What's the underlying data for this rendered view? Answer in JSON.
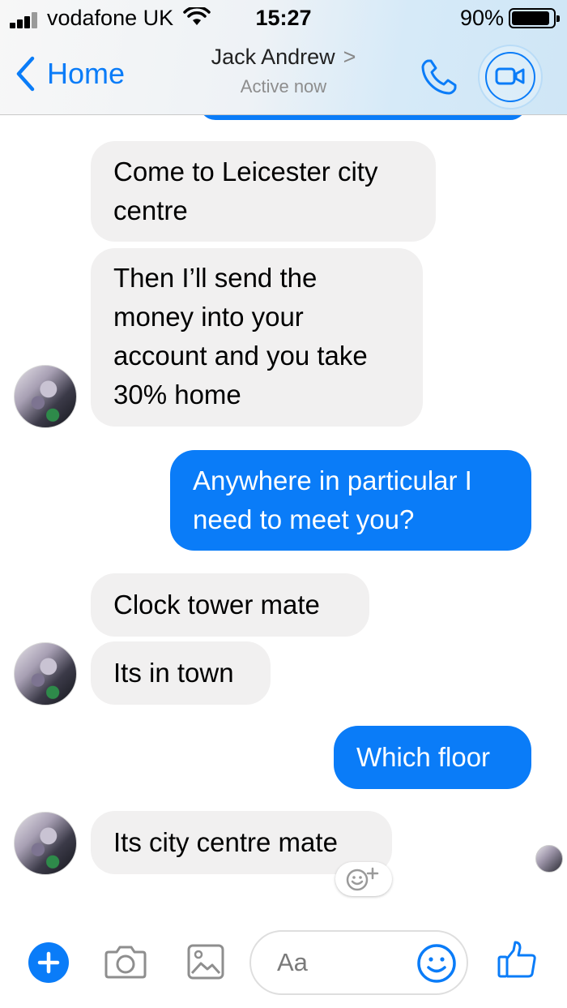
{
  "status_bar": {
    "carrier": "vodafone UK",
    "time": "15:27",
    "battery": "90%"
  },
  "header": {
    "back_label": "Home",
    "contact_name": "Jack Andrew",
    "chevron": ">",
    "status": "Active now"
  },
  "messages": [
    {
      "from": "them",
      "lines": [
        "Come to Leicester city",
        "centre"
      ]
    },
    {
      "from": "them",
      "lines": [
        "Then I’ll send the",
        "money into your",
        "account and you take",
        "30% home"
      ]
    },
    {
      "from": "me",
      "lines": [
        "Anywhere in particular I",
        "need to meet you?"
      ]
    },
    {
      "from": "them",
      "lines": [
        "Clock tower mate"
      ]
    },
    {
      "from": "them",
      "lines": [
        "Its in town"
      ]
    },
    {
      "from": "me",
      "lines": [
        "Which floor"
      ]
    },
    {
      "from": "them",
      "lines": [
        "Its city centre mate"
      ]
    }
  ],
  "composer": {
    "placeholder": "Aa"
  },
  "icons": {
    "back": "chevron-left-icon",
    "call": "phone-icon",
    "video": "video-camera-icon",
    "plus": "plus-icon",
    "camera": "camera-icon",
    "gallery": "image-icon",
    "emoji": "smiley-icon",
    "like": "thumbs-up-icon",
    "react": "add-reaction-icon"
  },
  "colors": {
    "accent": "#0a7cf8",
    "incoming_bubble": "#f1f0f0",
    "outgoing_text": "#ffffff"
  }
}
